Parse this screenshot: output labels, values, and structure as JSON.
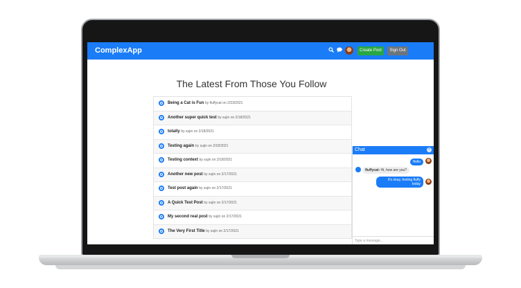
{
  "app": {
    "brand": "ComplexApp",
    "create_post": "Create Post",
    "sign_out": "Sign Out",
    "search_icon": "search-icon",
    "chat_icon": "chat-icon"
  },
  "page": {
    "title": "The Latest From Those You Follow"
  },
  "feed": [
    {
      "title": "Being a Cat is Fun",
      "meta": "by fluffycat on 2/23/2021"
    },
    {
      "title": "Another super quick test",
      "meta": "by sujin on 2/18/2021"
    },
    {
      "title": "totally",
      "meta": "by sujin on 2/18/2021"
    },
    {
      "title": "Testing again",
      "meta": "by sujin on 2/18/2021"
    },
    {
      "title": "Testing context",
      "meta": "by sujin on 2/18/2021"
    },
    {
      "title": "Another new post",
      "meta": "by sujin on 2/17/2021"
    },
    {
      "title": "Test post again",
      "meta": "by sujin on 2/17/2021"
    },
    {
      "title": "A Quick Test Post",
      "meta": "by sujin on 2/17/2021"
    },
    {
      "title": "My second real post",
      "meta": "by sujin on 2/17/2021"
    },
    {
      "title": "The Very First Title",
      "meta": "by sujin on 2/17/2021"
    }
  ],
  "chat": {
    "title": "Chat",
    "close": "×",
    "msg1": "Hello",
    "msg2_user": "fluffycat:",
    "msg2_text": " Hi, how are you?",
    "msg3_line1": "It's okay, feeling fluffy",
    "msg3_line2": "today",
    "input_placeholder": "Type a message..."
  }
}
